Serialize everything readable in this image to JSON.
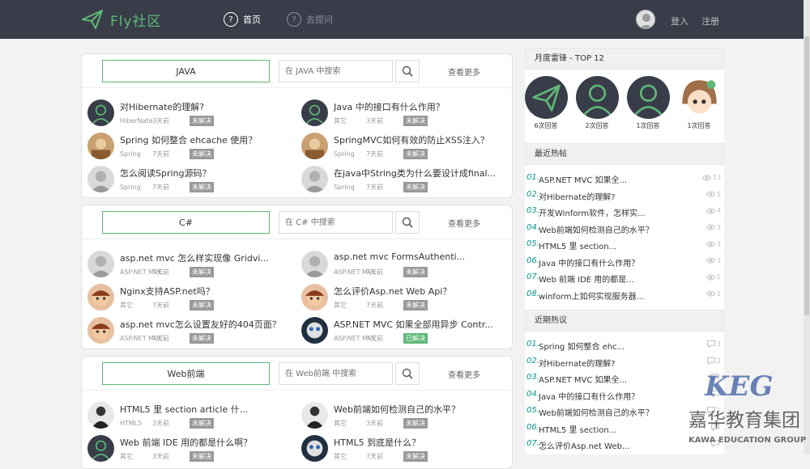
{
  "header": {
    "logo_text": "Fly社区",
    "nav_home": "首页",
    "nav_ask": "去提问",
    "login": "登入",
    "register": "注册"
  },
  "panels": [
    {
      "category": "JAVA",
      "search_placeholder": "在 JAVA 中搜索",
      "more": "查看更多",
      "posts": [
        {
          "title": "对Hibernate的理解?",
          "cat": "HiberNate",
          "time": "3天前",
          "status": "未解决",
          "avatar": "green-face"
        },
        {
          "title": "Java 中的接口有什么作用？",
          "cat": "其它",
          "time": "3天前",
          "status": "未解决",
          "avatar": "green-face"
        },
        {
          "title": "Spring 如何整合 ehcache 使用？",
          "cat": "Spring",
          "time": "7天前",
          "status": "未解决",
          "avatar": "brown-photo"
        },
        {
          "title": "SpringMVC如何有效的防止XSS注入？",
          "cat": "Spring",
          "time": "7天前",
          "status": "未解决",
          "avatar": "brown-photo"
        },
        {
          "title": "怎么阅读Spring源码？",
          "cat": "Spring",
          "time": "7天前",
          "status": "未解决",
          "avatar": "gray-photo"
        },
        {
          "title": "在java中String类为什么要设计成final...",
          "cat": "Spring",
          "time": "7天前",
          "status": "未解决",
          "avatar": "gray-photo"
        }
      ]
    },
    {
      "category": "C#",
      "search_placeholder": "在 C# 中搜索",
      "more": "查看更多",
      "posts": [
        {
          "title": "asp.net mvc 怎么样实现像 Gridvi...",
          "cat": "ASP.NET MVC",
          "time": "7天前",
          "status": "未解决",
          "avatar": "gray-photo"
        },
        {
          "title": "asp.net mvc FormsAuthenti...",
          "cat": "ASP.NET MVC",
          "time": "7天前",
          "status": "未解决",
          "avatar": "gray-photo"
        },
        {
          "title": "Nginx支持ASP.net吗？",
          "cat": "其它",
          "time": "7天前",
          "status": "未解决",
          "avatar": "cartoon-boy"
        },
        {
          "title": "怎么评价Asp.net Web Api？",
          "cat": "其它",
          "time": "7天前",
          "status": "未解决",
          "avatar": "cartoon-boy"
        },
        {
          "title": "asp.net mvc怎么设置友好的404页面？",
          "cat": "ASP.NET MVC",
          "time": "7天前",
          "status": "未解决",
          "avatar": "cartoon-boy"
        },
        {
          "title": "ASP.NET MVC 如果全部用异步 Contr...",
          "cat": "ASP.NET MVC",
          "time": "7天前",
          "status": "已解决",
          "avatar": "blue-cartoon"
        }
      ]
    },
    {
      "category": "Web前端",
      "search_placeholder": "在 Web前端 中搜索",
      "more": "查看更多",
      "posts": [
        {
          "title": "HTML5 里 section article 什...",
          "cat": "HTML5",
          "time": "3天前",
          "status": "未解决",
          "avatar": "dark-figure"
        },
        {
          "title": "Web前端如何检测自己的水平？",
          "cat": "其它",
          "time": "3天前",
          "status": "未解决",
          "avatar": "dark-figure"
        },
        {
          "title": "Web 前端 IDE 用的都是什么啊？",
          "cat": "其它",
          "time": "3天前",
          "status": "未解决",
          "avatar": "green-face"
        },
        {
          "title": "HTML5 到底是什么？",
          "cat": "其它",
          "time": "7天前",
          "status": "未解决",
          "avatar": "blue-cartoon"
        }
      ]
    }
  ],
  "sidebar": {
    "top_title": "月度雷锋 - TOP 12",
    "top_users": [
      {
        "count": "6次回答",
        "avatar": "plane"
      },
      {
        "count": "2次回答",
        "avatar": "green-face"
      },
      {
        "count": "1次回答",
        "avatar": "green-face"
      },
      {
        "count": "1次回答",
        "avatar": "anime-girl"
      }
    ],
    "hot_title": "最近热帖",
    "hot_posts": [
      {
        "num": "01.",
        "title": "ASP.NET MVC 如果全...",
        "stat": "13"
      },
      {
        "num": "02.",
        "title": "对Hibernate的理解?",
        "stat": "5"
      },
      {
        "num": "03.",
        "title": "开发Winform软件，怎样实...",
        "stat": "4"
      },
      {
        "num": "04.",
        "title": "Web前端如何检测自己的水平？",
        "stat": "3"
      },
      {
        "num": "05.",
        "title": "HTML5 里 section...",
        "stat": "3"
      },
      {
        "num": "06.",
        "title": "Java 中的接口有什么作用？",
        "stat": "3"
      },
      {
        "num": "07.",
        "title": "Web 前端 IDE 用的都是...",
        "stat": "1"
      },
      {
        "num": "08.",
        "title": "winform上如何实现服务器...",
        "stat": "1"
      }
    ],
    "discuss_title": "近期热议",
    "discuss_posts": [
      {
        "num": "01.",
        "title": "Spring 如何整合 ehc...",
        "stat": "3"
      },
      {
        "num": "02.",
        "title": "对Hibernate的理解?",
        "stat": "2"
      },
      {
        "num": "03.",
        "title": "ASP.NET MVC 如果全...",
        "stat": ""
      },
      {
        "num": "04.",
        "title": "Java 中的接口有什么作用？",
        "stat": ""
      },
      {
        "num": "05.",
        "title": "Web前端如何检测自己的水平？",
        "stat": "1"
      },
      {
        "num": "06.",
        "title": "HTML5 里 section...",
        "stat": ""
      },
      {
        "num": "07.",
        "title": "怎么评价Asp.net Web...",
        "stat": ""
      }
    ]
  },
  "watermark": {
    "logo": "KEG",
    "name_cn": "嘉华教育集团",
    "name_en": "KAWA EDUCATION GROUP"
  },
  "colors": {
    "header_bg": "#393d49",
    "accent_green": "#5fb878",
    "rank_num": "#009688",
    "badge_unsolved": "#999999",
    "badge_solved": "#5fb878"
  }
}
